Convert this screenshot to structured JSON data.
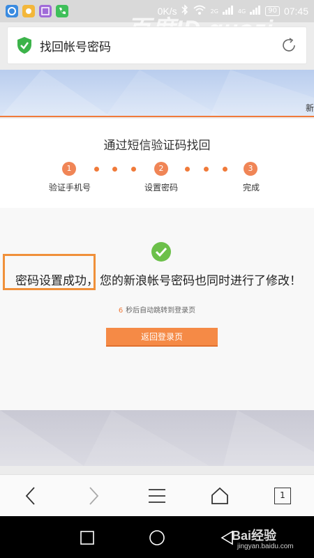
{
  "status_bar": {
    "speed": "0K/s",
    "network_2g": "2G",
    "network_4g": "4G",
    "battery": "90",
    "time": "07:45"
  },
  "watermark_top": "百度ID guozi",
  "address_bar": {
    "title": "找回帐号密码",
    "security_icon": "shield-check-icon",
    "reload_icon": "refresh-icon"
  },
  "banner": {
    "edge_char": "新"
  },
  "steps": {
    "title": "通过短信验证码找回",
    "items": [
      {
        "number": "1",
        "label": "验证手机号"
      },
      {
        "number": "2",
        "label": "设置密码"
      },
      {
        "number": "3",
        "label": "完成"
      }
    ]
  },
  "result": {
    "highlight": "密码设置成功，",
    "message": "您的新浪帐号密码也同时进行了修改！",
    "countdown_number": "6",
    "countdown_text": "秒后自动跳转到登录页",
    "back_button": "返回登录页"
  },
  "toolbar": {
    "tab_count": "1"
  },
  "watermark_bottom": {
    "brand": "Bai经验",
    "url": "jingyan.baidu.com"
  },
  "colors": {
    "accent": "#f07a3a",
    "button": "#f58a46",
    "success_green": "#6cc04a"
  }
}
